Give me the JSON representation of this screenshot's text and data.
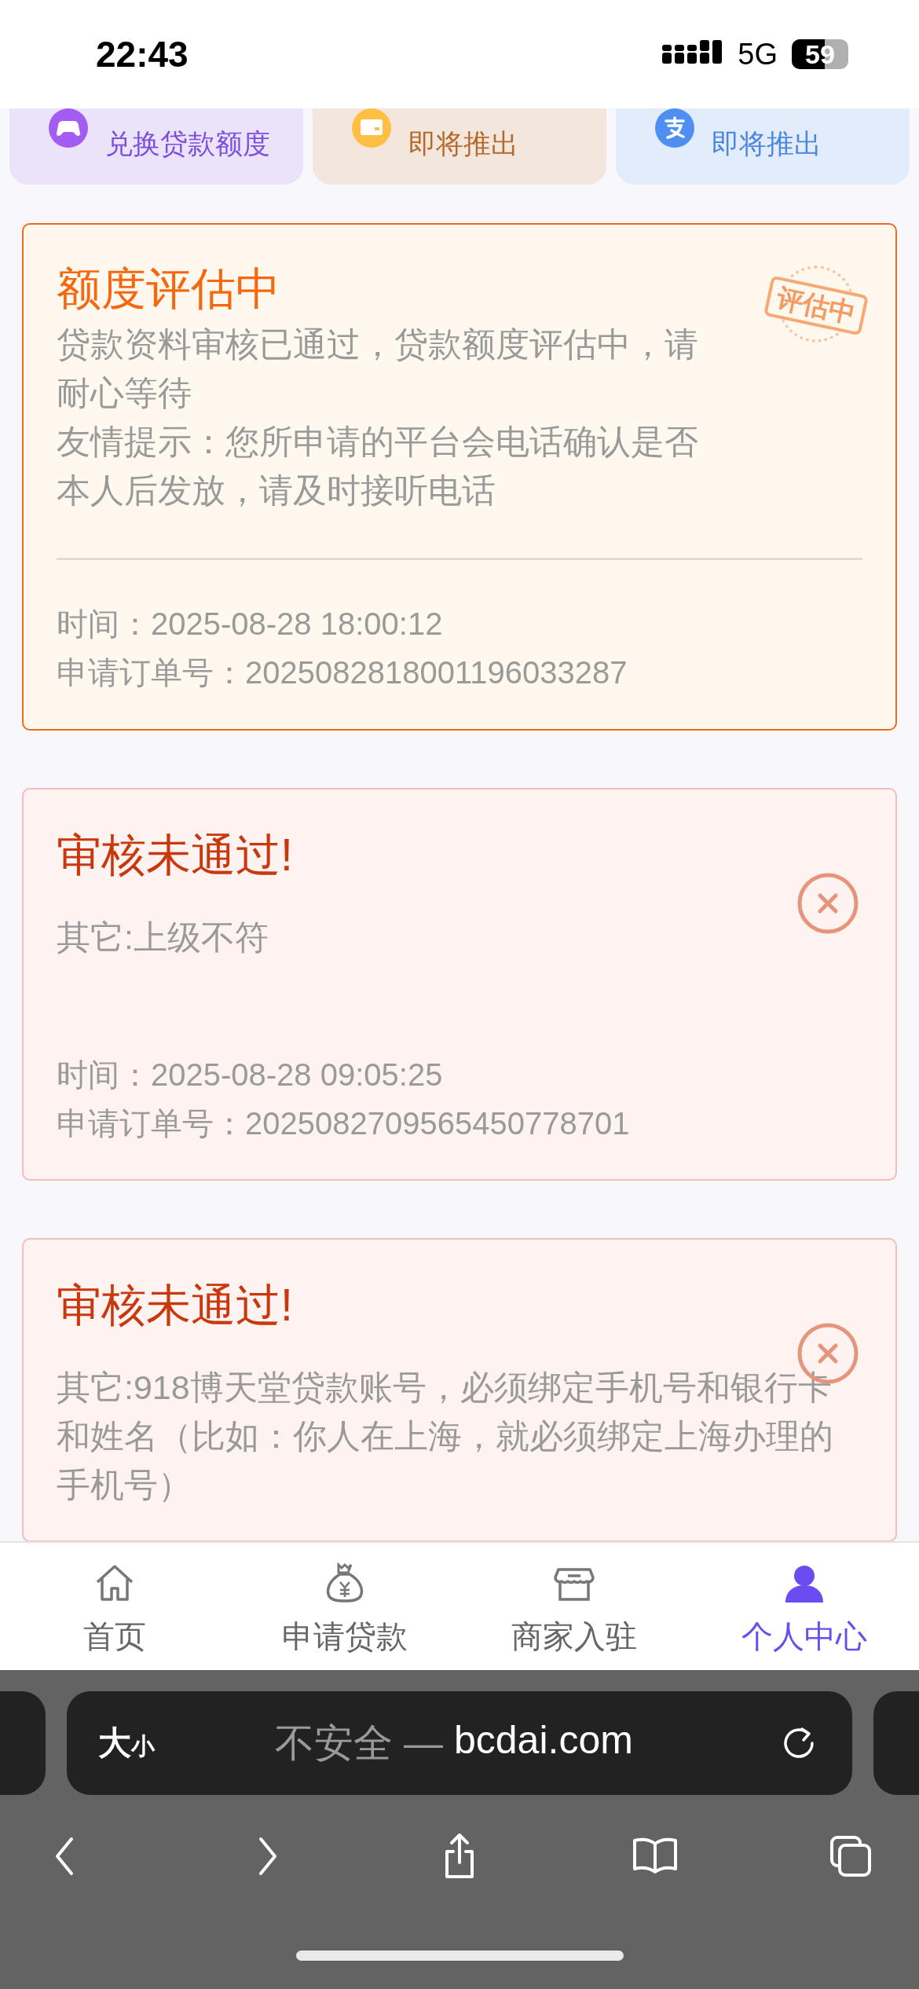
{
  "status_bar": {
    "time": "22:43",
    "network": "5G",
    "battery": "59"
  },
  "feature_tiles": [
    {
      "kind": "gamepad",
      "subtitle": "兑换贷款额度",
      "color": "#7d4fe0"
    },
    {
      "kind": "card",
      "subtitle": "即将推出",
      "color": "#b46a2c"
    },
    {
      "kind": "pay",
      "subtitle": "即将推出",
      "color": "#4b86e0"
    }
  ],
  "records": [
    {
      "kind": "evaluating",
      "title": "额度评估中",
      "stamp": "评估中",
      "paragraphs": [
        "贷款资料审核已通过，贷款额度评估中，请耐心等待",
        "友情提示：您所申请的平台会电话确认是否本人后发放，请及时接听电话"
      ],
      "time": "时间：2025-08-28 18:00:12",
      "order": "申请订单号：2025082818001196033287"
    },
    {
      "kind": "rejected",
      "title": "审核未通过!",
      "paragraphs": [
        "其它:上级不符"
      ],
      "time": "时间：2025-08-28 09:05:25",
      "order": "申请订单号：2025082709565450778701"
    },
    {
      "kind": "rejected",
      "title": "审核未通过!",
      "paragraphs": [
        "其它:918博天堂贷款账号，必须绑定手机号和银行卡和姓名（比如：你人在上海，就必须绑定上海办理的手机号）"
      ]
    }
  ],
  "tab_bar": [
    {
      "kind": "home",
      "label": "首页",
      "selected": false
    },
    {
      "kind": "moneybag",
      "label": "申请贷款",
      "selected": false
    },
    {
      "kind": "shop",
      "label": "商家入驻",
      "selected": false
    },
    {
      "kind": "person",
      "label": "个人中心",
      "selected": true
    }
  ],
  "browser": {
    "text_size_big": "大",
    "text_size_small": "小",
    "security": "不安全 —",
    "domain": "bcdai.com"
  }
}
